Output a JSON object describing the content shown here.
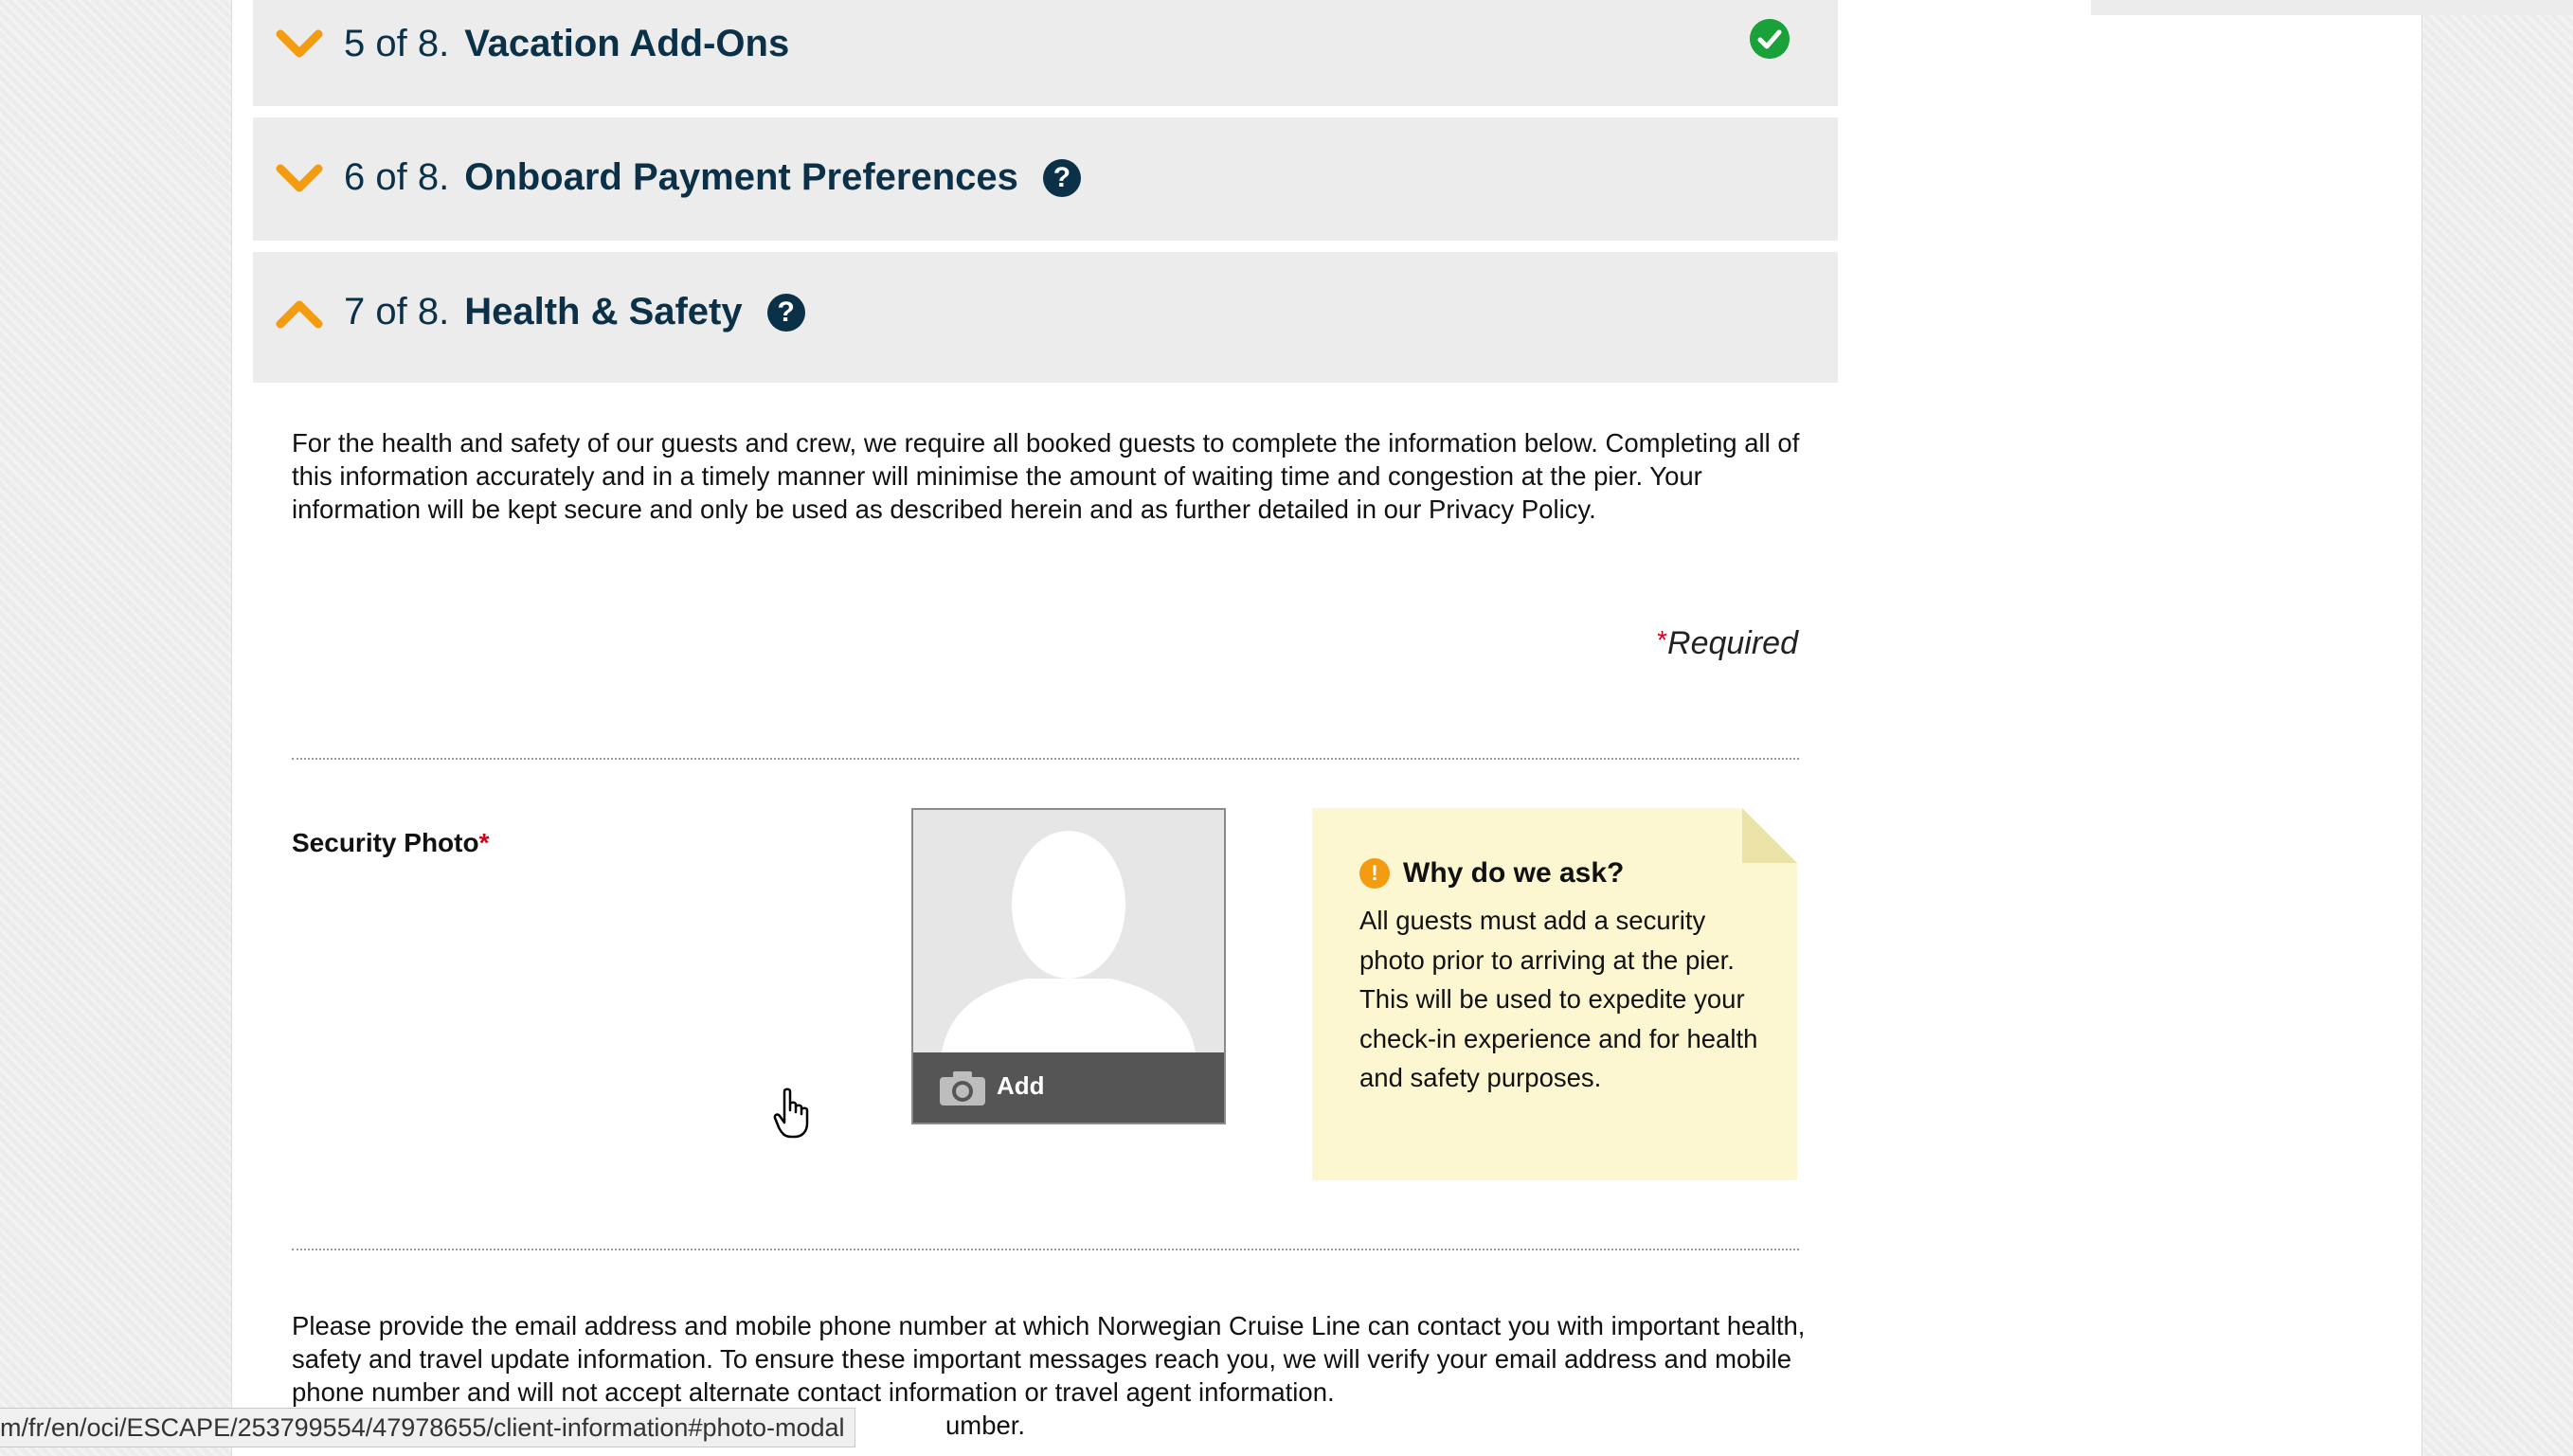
{
  "accordion": {
    "sections": [
      {
        "num": "5 of 8.",
        "title": "Vacation Add-Ons",
        "icon": "chevron-down-icon",
        "status_icon": "check-circle-icon"
      },
      {
        "num": "6 of 8.",
        "title": "Onboard Payment Preferences",
        "icon": "chevron-down-icon",
        "help_icon": "?"
      },
      {
        "num": "7 of 8.",
        "title": "Health & Safety",
        "icon": "chevron-up-icon",
        "help_icon": "?"
      }
    ]
  },
  "health_safety": {
    "intro": "For the health and safety of our guests and crew, we require all booked guests to complete the information below. Completing all of this information accurately and in a timely manner will minimise the amount of waiting time and congestion at the pier. Your information will be kept secure and only be used as described herein and as further detailed in our Privacy Policy.",
    "required_marker": "*",
    "required_label": "Required",
    "security_photo_label": "Security Photo",
    "add_button_label": "Add",
    "why": {
      "info_icon": "!",
      "title": "Why do we ask?",
      "text": "All guests must add a security photo prior to arriving at the pier. This will be used to expedite your check-in experience and for health and safety purposes."
    },
    "contact_text_visible": "Please provide the email address and mobile phone number at which Norwegian Cruise Line can contact you with important health, safety and travel update information. To ensure these important messages reach you, we will verify your email address and mobile phone number and will not accept alternate contact information or travel agent information.",
    "contact_text_tail": "umber."
  },
  "status_bar": {
    "url": "m/fr/en/oci/ESCAPE/253799554/47978655/client-information#photo-modal"
  },
  "colors": {
    "accent_orange": "#f39c12",
    "heading_navy": "#0b3149",
    "success_green": "#1aa13a",
    "required_red": "#d0021b",
    "note_yellow": "#fdf7d1"
  }
}
